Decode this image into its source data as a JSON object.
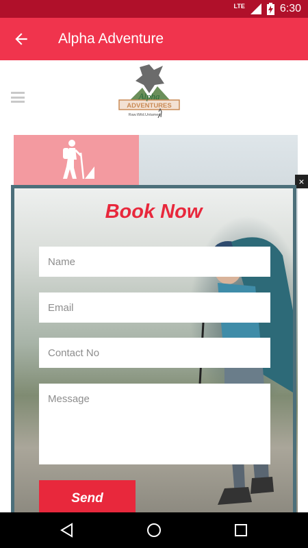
{
  "status_bar": {
    "network": "LTE",
    "time": "6:30"
  },
  "app_bar": {
    "title": "Alpha Adventure"
  },
  "logo": {
    "text": "Alpha ADVENTURES",
    "tagline": "Raw.Wild.Untamed"
  },
  "modal": {
    "title": "Book Now",
    "close_label": "×",
    "fields": {
      "name_placeholder": "Name",
      "email_placeholder": "Email",
      "contact_placeholder": "Contact No",
      "message_placeholder": "Message"
    },
    "send_label": "Send"
  },
  "colors": {
    "accent": "#f0344d",
    "status_bar": "#b0102a",
    "modal_border": "#4c6f7a",
    "tile": "#f39aa0"
  }
}
